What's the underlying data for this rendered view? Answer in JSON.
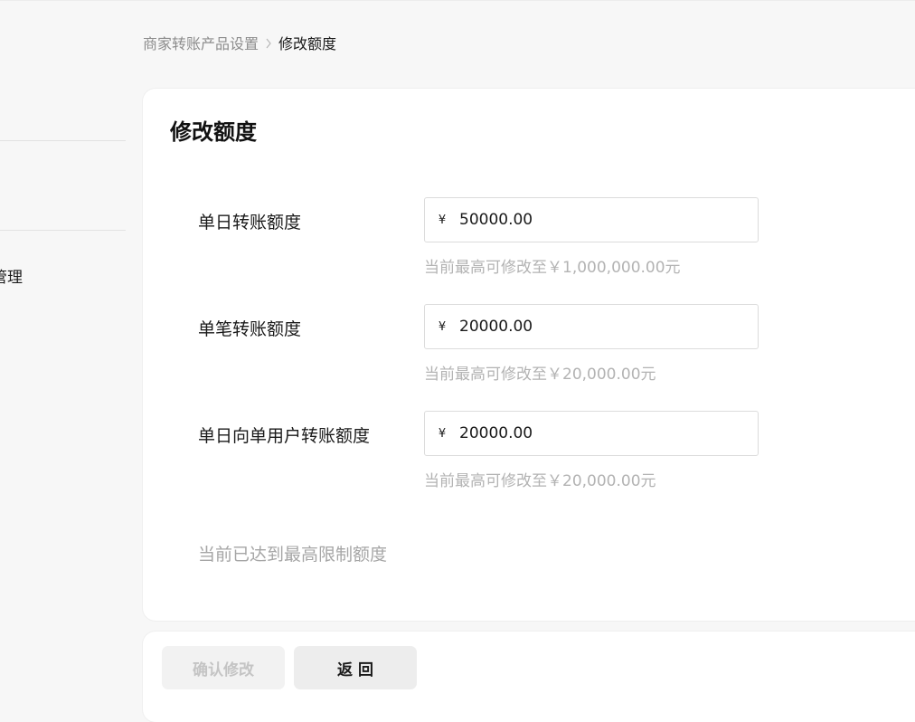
{
  "sidebar": {
    "partial_item_label": "管理"
  },
  "breadcrumb": {
    "parent": "商家转账产品设置",
    "current": "修改额度"
  },
  "form": {
    "title": "修改额度",
    "currency_symbol": "¥",
    "fields": [
      {
        "label": "单日转账额度",
        "value": "50000.00",
        "hint": "当前最高可修改至￥1,000,000.00元"
      },
      {
        "label": "单笔转账额度",
        "value": "20000.00",
        "hint": "当前最高可修改至￥20,000.00元"
      },
      {
        "label": "单日向单用户转账额度",
        "value": "20000.00",
        "hint": "当前最高可修改至￥20,000.00元"
      }
    ],
    "limit_note": "当前已达到最高限制额度"
  },
  "actions": {
    "confirm_label": "确认修改",
    "confirm_disabled": true,
    "back_label": "返 回"
  },
  "colors": {
    "page_background": "#f7f7f7",
    "card_background": "#ffffff",
    "hint_text": "#b3b3b3",
    "disabled_button_text": "#c4c4c4"
  }
}
